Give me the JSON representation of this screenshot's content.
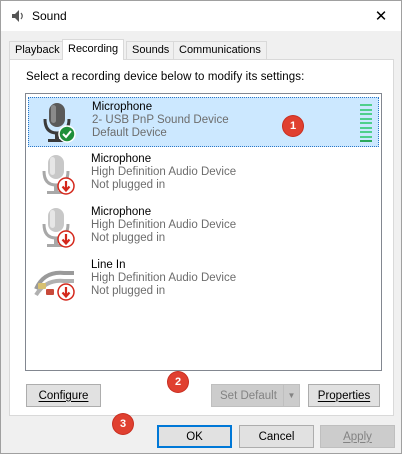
{
  "window": {
    "title": "Sound",
    "close_glyph": "✕"
  },
  "tabs": [
    {
      "label": "Playback",
      "active": false
    },
    {
      "label": "Recording",
      "active": true
    },
    {
      "label": "Sounds",
      "active": false
    },
    {
      "label": "Communications",
      "active": false
    }
  ],
  "instruction": "Select a recording device below to modify its settings:",
  "devices": [
    {
      "name": "Microphone",
      "description": "2- USB PnP Sound Device",
      "status": "Default Device",
      "icon": "microphone-icon",
      "badge": "default-check-icon",
      "selected": true
    },
    {
      "name": "Microphone",
      "description": "High Definition Audio Device",
      "status": "Not plugged in",
      "icon": "microphone-icon",
      "badge": "unplugged-arrow-icon",
      "selected": false
    },
    {
      "name": "Microphone",
      "description": "High Definition Audio Device",
      "status": "Not plugged in",
      "icon": "microphone-icon",
      "badge": "unplugged-arrow-icon",
      "selected": false
    },
    {
      "name": "Line In",
      "description": "High Definition Audio Device",
      "status": "Not plugged in",
      "icon": "line-in-cable-icon",
      "badge": "unplugged-arrow-icon",
      "selected": false
    }
  ],
  "buttons": {
    "configure": "Configure",
    "set_default": "Set Default",
    "properties": "Properties",
    "ok": "OK",
    "cancel": "Cancel",
    "apply": "Apply"
  },
  "callouts": [
    "1",
    "2",
    "3"
  ],
  "colors": {
    "selection": "#cce8ff",
    "callout": "#e04030",
    "level_meter": "#4fcf8c",
    "default_check": "#1f8f3a",
    "unplugged_badge": "#d4271b"
  }
}
